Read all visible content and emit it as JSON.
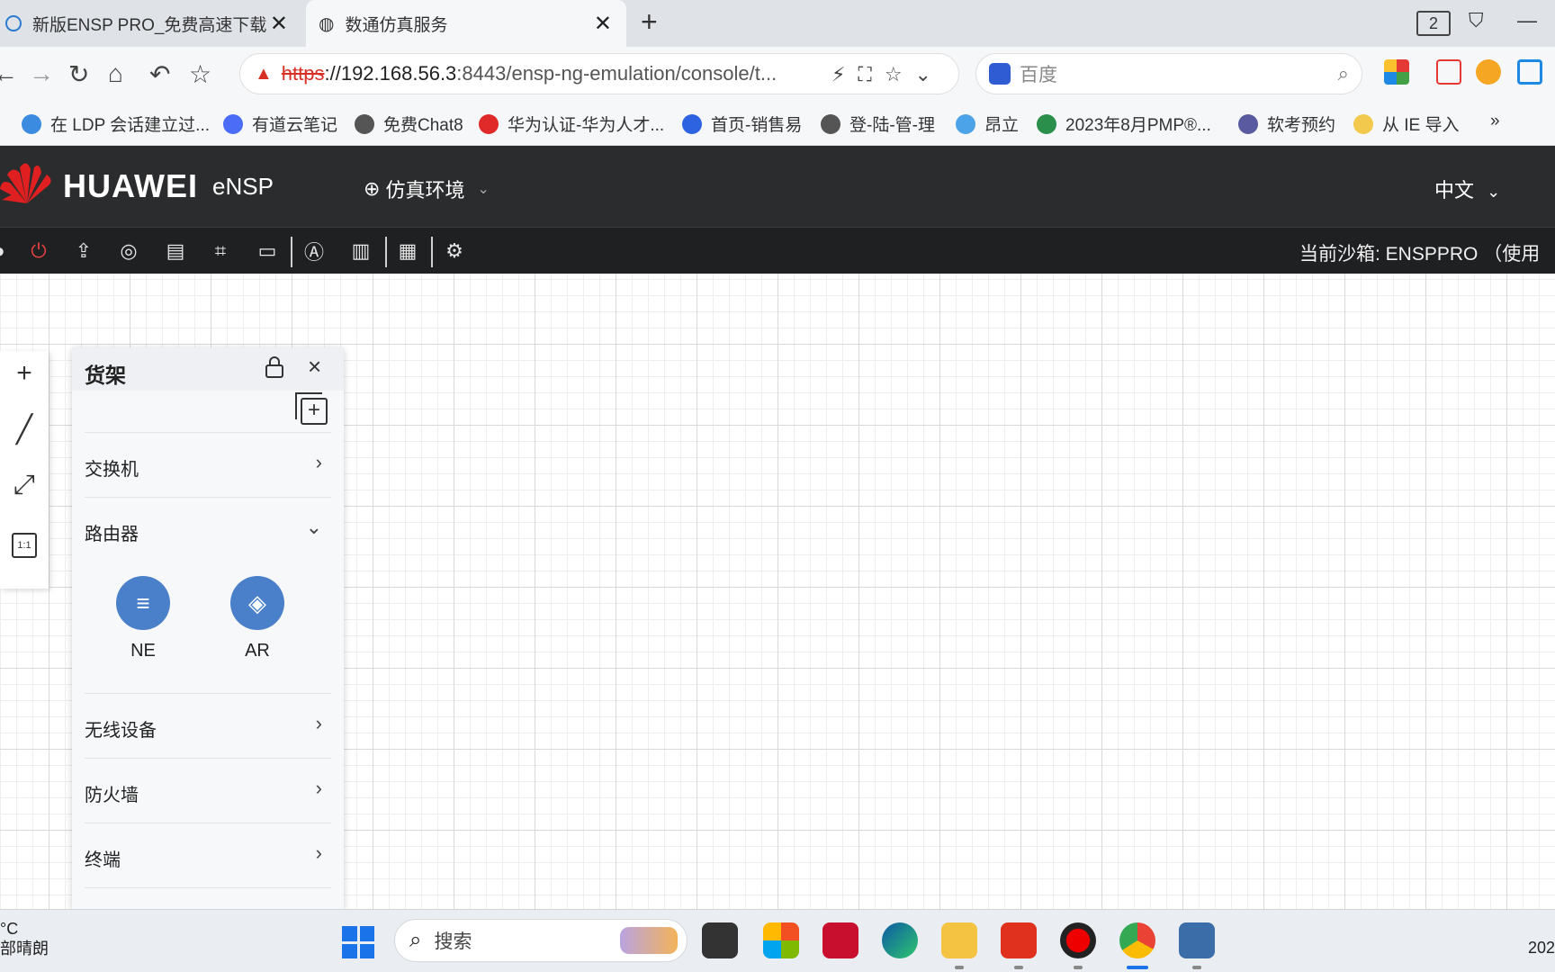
{
  "browser": {
    "tabs": [
      {
        "title": "新版ENSP PRO_免费高速下载|百",
        "close": "✕"
      },
      {
        "title": "数通仿真服务",
        "close": "✕"
      }
    ],
    "new_tab": "+",
    "window_badge": "2",
    "url": {
      "protocol": "https",
      "host": "://192.168.56.3",
      "rest": ":8443/ensp-ng-emulation/console/t..."
    },
    "search_placeholder": "百度",
    "bookmarks": [
      {
        "label": "在 LDP 会话建立过...",
        "color": "#3b8be0"
      },
      {
        "label": "有道云笔记",
        "color": "#4a6cf7"
      },
      {
        "label": "免费Chat8",
        "color": "#555555"
      },
      {
        "label": "华为认证-华为人才...",
        "color": "#e02a2a"
      },
      {
        "label": "首页-销售易",
        "color": "#2d63e0"
      },
      {
        "label": "登-陆-管-理",
        "color": "#555555"
      },
      {
        "label": "昂立",
        "color": "#4da3e8"
      },
      {
        "label": "2023年8月PMP®...",
        "color": "#2a8f4a"
      },
      {
        "label": "软考预约",
        "color": "#5a5aa0"
      },
      {
        "label": "从 IE 导入",
        "color": "#f2c94c"
      }
    ],
    "bookmarks_more": "»"
  },
  "app": {
    "brand": "HUAWEI",
    "product": "eNSP",
    "environment": "仿真环境",
    "language": "中文",
    "sandbox_text": "当前沙箱:  ENSPPRO （使用"
  },
  "shelf": {
    "title": "货架",
    "categories": [
      {
        "label": "交换机",
        "chevron": "›"
      },
      {
        "label": "路由器",
        "chevron": "⌄"
      },
      {
        "label": "无线设备",
        "chevron": "›"
      },
      {
        "label": "防火墙",
        "chevron": "›"
      },
      {
        "label": "终端",
        "chevron": "›"
      }
    ],
    "devices": [
      {
        "label": "NE",
        "glyph": "≡"
      },
      {
        "label": "AR",
        "glyph": "◈"
      }
    ]
  },
  "taskbar": {
    "weather_temp": "°C",
    "weather_desc": "部晴朗",
    "search_label": "搜索",
    "clock": "202"
  },
  "colors": {
    "header_bg": "#2b2c2e",
    "toolbar_bg": "#1f2022",
    "device_blue": "#4a80c9",
    "power_red": "#e04040"
  }
}
